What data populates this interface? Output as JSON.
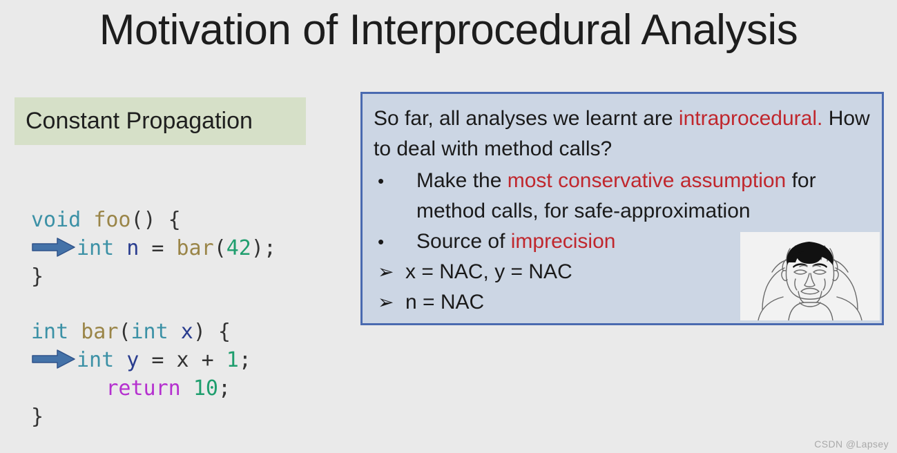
{
  "slide": {
    "title": "Motivation of Interprocedural Analysis",
    "background_color": "#eaeaea",
    "watermark": "CSDN @Lapsey"
  },
  "section_header": {
    "label": "Constant Propagation",
    "background_color": "#d6e0c8"
  },
  "code": {
    "foo": {
      "lines": [
        {
          "arrow": false,
          "tokens": [
            {
              "text": "void",
              "kind": "type"
            },
            {
              "text": " ",
              "kind": "plain"
            },
            {
              "text": "foo",
              "kind": "fn"
            },
            {
              "text": "() {",
              "kind": "punct"
            }
          ]
        },
        {
          "arrow": true,
          "tokens": [
            {
              "text": "int",
              "kind": "type"
            },
            {
              "text": " ",
              "kind": "plain"
            },
            {
              "text": "n",
              "kind": "var"
            },
            {
              "text": " = ",
              "kind": "punct"
            },
            {
              "text": "bar",
              "kind": "fn"
            },
            {
              "text": "(",
              "kind": "punct"
            },
            {
              "text": "42",
              "kind": "num"
            },
            {
              "text": ");",
              "kind": "punct"
            }
          ]
        },
        {
          "arrow": false,
          "tokens": [
            {
              "text": "}",
              "kind": "punct"
            }
          ]
        }
      ]
    },
    "bar": {
      "lines": [
        {
          "arrow": false,
          "tokens": [
            {
              "text": "int",
              "kind": "type"
            },
            {
              "text": " ",
              "kind": "plain"
            },
            {
              "text": "bar",
              "kind": "fn"
            },
            {
              "text": "(",
              "kind": "punct"
            },
            {
              "text": "int",
              "kind": "type"
            },
            {
              "text": " ",
              "kind": "plain"
            },
            {
              "text": "x",
              "kind": "var"
            },
            {
              "text": ") {",
              "kind": "punct"
            }
          ]
        },
        {
          "arrow": true,
          "tokens": [
            {
              "text": "int",
              "kind": "type"
            },
            {
              "text": " ",
              "kind": "plain"
            },
            {
              "text": "y",
              "kind": "var"
            },
            {
              "text": " = ",
              "kind": "punct"
            },
            {
              "text": "x",
              "kind": "plain"
            },
            {
              "text": " + ",
              "kind": "punct"
            },
            {
              "text": "1",
              "kind": "num"
            },
            {
              "text": ";",
              "kind": "punct"
            }
          ]
        },
        {
          "arrow": false,
          "indent": 3,
          "tokens": [
            {
              "text": "return",
              "kind": "kw"
            },
            {
              "text": " ",
              "kind": "plain"
            },
            {
              "text": "10",
              "kind": "num"
            },
            {
              "text": ";",
              "kind": "punct"
            }
          ]
        },
        {
          "arrow": false,
          "tokens": [
            {
              "text": "}",
              "kind": "punct"
            }
          ]
        }
      ]
    },
    "arrow_icon_name": "right-arrow-marker",
    "arrow_color": "#4472a8"
  },
  "info_panel": {
    "background_color": "#ccd6e4",
    "border_color": "#4a6ab0",
    "highlight_color": "#c0272d",
    "intro": [
      {
        "text": "So far, all analyses we learnt are ",
        "highlight": false
      },
      {
        "text": "intraprocedural.",
        "highlight": true
      },
      {
        "text": " How to deal with method calls?",
        "highlight": false
      }
    ],
    "intro_plain": "So far, all analyses we learnt are intraprocedural. How to deal with method calls?",
    "items": [
      {
        "marker": "•",
        "marker_name": "dot-bullet",
        "parts": [
          {
            "text": "Make the ",
            "highlight": false
          },
          {
            "text": "most conservative assumption",
            "highlight": true
          },
          {
            "text": " for method calls, for safe-approximation",
            "highlight": false
          }
        ],
        "plain": "Make the most conservative assumption for method calls, for safe-approximation"
      },
      {
        "marker": "•",
        "marker_name": "dot-bullet",
        "parts": [
          {
            "text": "Source of ",
            "highlight": false
          },
          {
            "text": "imprecision",
            "highlight": true
          }
        ],
        "plain": "Source of imprecision"
      },
      {
        "marker": "➢",
        "marker_name": "arrowhead-bullet",
        "parts": [
          {
            "text": "x = NAC, y = NAC",
            "highlight": false
          }
        ],
        "plain": "x = NAC, y = NAC"
      },
      {
        "marker": "➢",
        "marker_name": "arrowhead-bullet",
        "parts": [
          {
            "text": "n = NAC",
            "highlight": false
          }
        ],
        "plain": "n = NAC"
      }
    ]
  },
  "meme": {
    "icon_name": "confused-man-meme-image",
    "alt": "confused man holding his head"
  }
}
